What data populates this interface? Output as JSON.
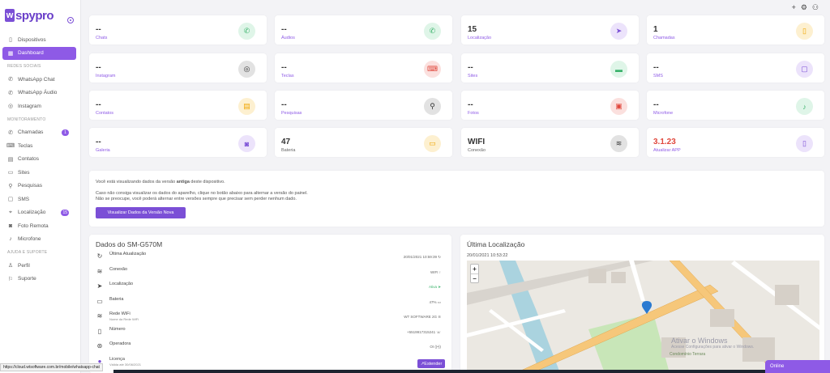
{
  "app": {
    "logo_mark": "w",
    "logo_text": "spypro"
  },
  "sidebar": {
    "items_top": [
      {
        "label": "Dispositivos",
        "icon": "phone-icon"
      },
      {
        "label": "Dashboard",
        "icon": "grid-icon",
        "active": true
      }
    ],
    "sections": [
      {
        "title": "REDES SOCIAIS",
        "items": [
          {
            "label": "WhatsApp Chat",
            "icon": "whatsapp-icon"
          },
          {
            "label": "WhatsApp Áudio",
            "icon": "whatsapp-audio-icon"
          },
          {
            "label": "Instagram",
            "icon": "instagram-icon"
          }
        ]
      },
      {
        "title": "MONITORAMENTO",
        "items": [
          {
            "label": "Chamadas",
            "icon": "phone-call-icon",
            "badge": "1"
          },
          {
            "label": "Teclas",
            "icon": "keyboard-icon"
          },
          {
            "label": "Contatos",
            "icon": "contacts-icon"
          },
          {
            "label": "Sites",
            "icon": "sites-icon"
          },
          {
            "label": "Pesquisas",
            "icon": "search-icon"
          },
          {
            "label": "SMS",
            "icon": "sms-icon"
          },
          {
            "label": "Localização",
            "icon": "location-icon",
            "badge": "15"
          },
          {
            "label": "Foto Remota",
            "icon": "camera-icon"
          },
          {
            "label": "Microfone",
            "icon": "microphone-icon"
          }
        ]
      },
      {
        "title": "AJUDA E SUPORTE",
        "items": [
          {
            "label": "Perfil",
            "icon": "user-icon"
          },
          {
            "label": "Suporte",
            "icon": "help-icon"
          }
        ]
      }
    ]
  },
  "stats": [
    {
      "value": "--",
      "label": "Chats",
      "icon": "whatsapp-icon",
      "color": "#3ab26b",
      "bg": "#dff5e8"
    },
    {
      "value": "--",
      "label": "Áudios",
      "icon": "whatsapp-icon",
      "color": "#3ab26b",
      "bg": "#dff5e8"
    },
    {
      "value": "15",
      "label": "Localização",
      "icon": "navigation-icon",
      "color": "#7b4fd6",
      "bg": "#ece3fb"
    },
    {
      "value": "1",
      "label": "Chamadas",
      "icon": "phone-icon",
      "color": "#f0a500",
      "bg": "#fdf0d0"
    },
    {
      "value": "--",
      "label": "Instagram",
      "icon": "instagram-icon",
      "color": "#333",
      "bg": "#e2e2e2"
    },
    {
      "value": "--",
      "label": "Teclas",
      "icon": "keyboard-icon",
      "color": "#e0473c",
      "bg": "#fbe0de"
    },
    {
      "value": "--",
      "label": "Sites",
      "icon": "browser-icon",
      "color": "#3ab26b",
      "bg": "#dff5e8"
    },
    {
      "value": "--",
      "label": "SMS",
      "icon": "sms-icon",
      "color": "#7b4fd6",
      "bg": "#ece3fb"
    },
    {
      "value": "--",
      "label": "Contatos",
      "icon": "contacts-icon",
      "color": "#f0a500",
      "bg": "#fdf0d0"
    },
    {
      "value": "--",
      "label": "Pesquisas",
      "icon": "search-icon",
      "color": "#333",
      "bg": "#e2e2e2"
    },
    {
      "value": "--",
      "label": "Fotos",
      "icon": "photo-icon",
      "color": "#e0473c",
      "bg": "#fbe0de"
    },
    {
      "value": "--",
      "label": "Microfone",
      "icon": "microphone-icon",
      "color": "#3ab26b",
      "bg": "#dff5e8"
    },
    {
      "value": "--",
      "label": "Galeria",
      "icon": "camera-icon",
      "color": "#7b4fd6",
      "bg": "#ece3fb"
    },
    {
      "value": "47",
      "label": "Bateria",
      "icon": "battery-icon",
      "color": "#f0a500",
      "bg": "#fdf0d0"
    },
    {
      "value": "WIFI",
      "label": "Conexão",
      "icon": "wifi-icon",
      "color": "#333",
      "bg": "#e2e2e2"
    },
    {
      "value": "3.1.23",
      "label": "Atualizar APP",
      "icon": "smartphone-icon",
      "color": "#7b4fd6",
      "bg": "#ece3fb"
    }
  ],
  "info": {
    "line1_pre": "Você está visualizando dados da versão ",
    "line1_bold": "antiga",
    "line1_post": " deste dispositivo.",
    "line2": "Caso não consiga visualizar os dados do aparelho, clique no botão abaixo para alternar a versão do painel.",
    "line3": "Não se preocupe, você poderá alternar entre versões sempre que precisar sem perder nenhum dado.",
    "button": "Visualizar Dados da Versão Nova"
  },
  "device": {
    "title": "Dados do SM-G570M",
    "rows": [
      {
        "label": "Última Atualização",
        "sub": "",
        "value": "20/01/2021 10:59:39 ↻",
        "icon": "refresh-icon"
      },
      {
        "label": "Conexão",
        "sub": "",
        "value": "WIFI ↑",
        "icon": "wifi-icon"
      },
      {
        "label": "Localização",
        "sub": "",
        "value": "Ativa ➤",
        "icon": "navigation-icon"
      },
      {
        "label": "Bateria",
        "sub": "",
        "value": "47% ▭",
        "icon": "battery-icon"
      },
      {
        "label": "Rede WiFi",
        "sub": "Nome da Rede WiFi",
        "value": "WT SOFTWARE 2G ≋",
        "icon": "wifi-icon"
      },
      {
        "label": "Número",
        "sub": "",
        "value": "+5519917315241 ☏",
        "icon": "phone-icon"
      },
      {
        "label": "Operadora",
        "sub": "",
        "value": "OI ((•))",
        "icon": "antenna-icon"
      },
      {
        "label": "Licença",
        "sub": "Válida até 30/06/2021",
        "value": "",
        "icon": "license-icon"
      }
    ],
    "extend": "Estender"
  },
  "map": {
    "title": "Última Localização",
    "date": "20/01/2021 10:53:22",
    "zoom_in": "+",
    "zoom_out": "−",
    "watermark": "Ativar o Windows",
    "watermark_sub": "Acesse Configurações para ativar o Windows.",
    "place": "Condomínio Terrara"
  },
  "statusbar": {
    "url": "https://cloud.wtsoftware.com.br/mobile/whatsapp-chat"
  },
  "online": "Online"
}
